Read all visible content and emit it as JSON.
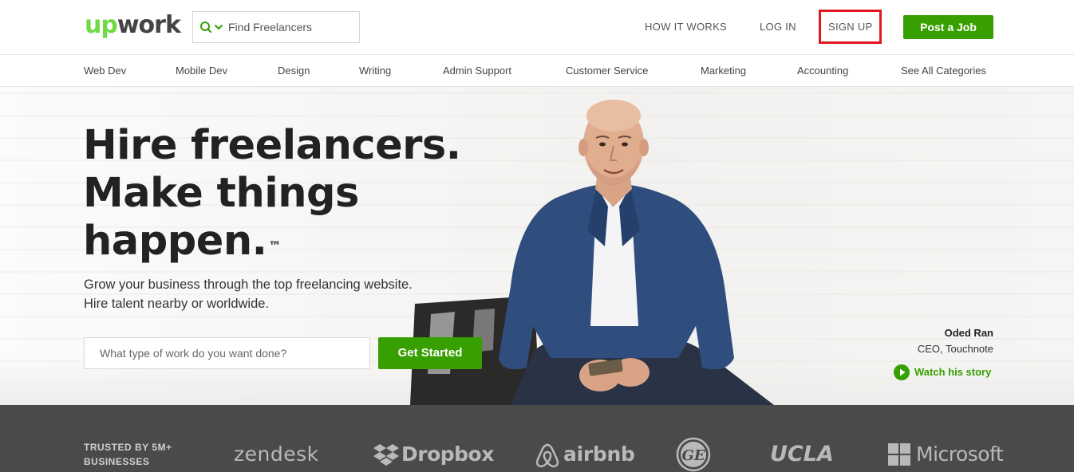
{
  "header": {
    "logo_up": "up",
    "logo_work": "work",
    "search_placeholder": "Find Freelancers",
    "nav": {
      "how_it_works": "HOW IT WORKS",
      "log_in": "LOG IN",
      "sign_up": "SIGN UP"
    },
    "post_job_label": "Post a Job"
  },
  "categories": [
    "Web Dev",
    "Mobile Dev",
    "Design",
    "Writing",
    "Admin Support",
    "Customer Service",
    "Marketing",
    "Accounting",
    "See All Categories"
  ],
  "hero": {
    "headline_1": "Hire freelancers.",
    "headline_2": "Make things",
    "headline_3": "happen.",
    "trademark": "™",
    "subhead": "Grow your business through the top freelancing website. Hire talent nearby or worldwide.",
    "input_placeholder": "What type of work do you want done?",
    "cta_label": "Get Started",
    "quote_name": "Oded Ran",
    "quote_title": "CEO, Touchnote",
    "watch_label": "Watch his story"
  },
  "trusted": {
    "label": "TRUSTED BY 5M+ BUSINESSES",
    "brands": {
      "zendesk": "zendesk",
      "dropbox": "Dropbox",
      "airbnb": "airbnb",
      "ge": "GE",
      "ucla": "UCLA",
      "microsoft": "Microsoft"
    }
  },
  "colors": {
    "brand_green": "#37a000",
    "logo_green": "#6fda44",
    "highlight_red": "#e0161f",
    "trusted_bg": "#4a4a4a"
  },
  "icons": {
    "search": "search-icon",
    "dropdown": "chevron-down-icon",
    "play": "play-icon"
  }
}
